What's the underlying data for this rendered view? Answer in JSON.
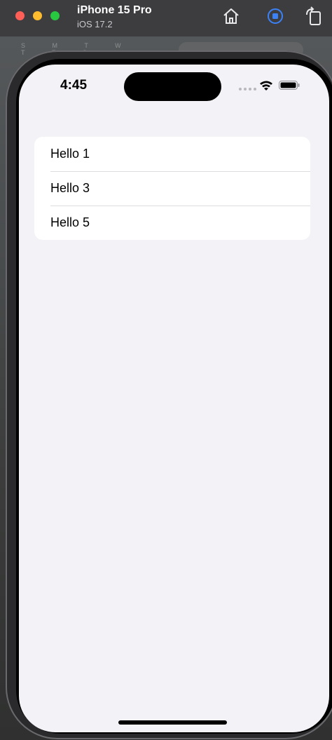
{
  "simulator": {
    "device_name": "iPhone 15 Pro",
    "os_version": "iOS 17.2"
  },
  "backdrop": {
    "calendar_letters": "S M T W T F S"
  },
  "status_bar": {
    "time": "4:45"
  },
  "list": {
    "items": [
      {
        "label": "Hello 1"
      },
      {
        "label": "Hello 3"
      },
      {
        "label": "Hello 5"
      }
    ]
  },
  "colors": {
    "screen_background": "#f2f2f7",
    "list_background": "#ffffff",
    "accent_blue": "#3b82f6"
  }
}
